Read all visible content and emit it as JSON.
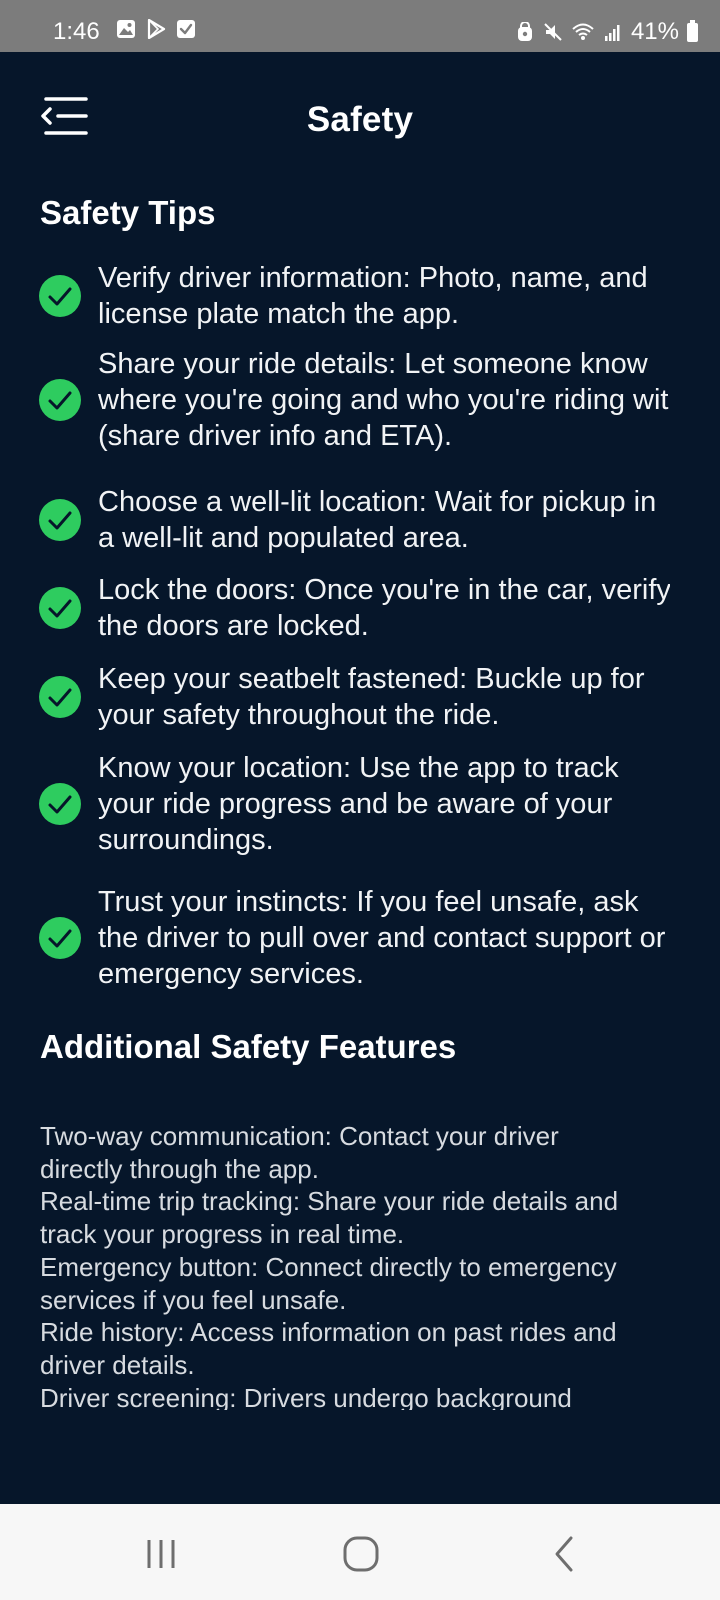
{
  "status_bar": {
    "time": "1:46",
    "battery": "41%",
    "left_icons": [
      "gallery-icon",
      "play-store-icon",
      "check-box-icon"
    ],
    "right_icons": [
      "lock-icon",
      "mute-icon",
      "wifi-icon",
      "signal-icon",
      "battery-icon"
    ]
  },
  "header": {
    "title": "Safety",
    "menu_icon": "menu-collapse-icon"
  },
  "safety_tips": {
    "title": "Safety Tips",
    "items": [
      "Verify driver information: Photo, name, and\nlicense plate match the app.",
      "Share your ride details: Let someone know\nwhere you're going and who you're riding with\n(share driver info and ETA).",
      "Choose a well-lit location: Wait for pickup in\na well-lit and populated area.",
      "Lock the doors: Once you're in the car, verify\nthe doors are locked.",
      "Keep your seatbelt fastened: Buckle up for\nyour safety throughout the ride.",
      "Know your location: Use the app to track\nyour ride progress and be aware of your\nsurroundings.",
      "Trust your instincts: If you feel unsafe, ask\nthe driver to pull over and contact support or\nemergency services."
    ]
  },
  "additional_features": {
    "title": "Additional Safety Features",
    "text": "Two-way communication: Contact your driver\ndirectly through the app.\nReal-time trip tracking: Share your ride details and\ntrack your progress in real time.\nEmergency button: Connect directly to emergency\nservices if you feel unsafe.\nRide history: Access information on past rides and\ndriver details.\nDriver screening: Drivers undergo background\nchecks and safety training before joining the"
  },
  "colors": {
    "background": "#06162a",
    "check": "#2ecc5f",
    "status_bar": "#7c7c7c",
    "nav_bar": "#f7f7f7"
  },
  "nav_bar": {
    "icons": [
      "recent-apps-icon",
      "home-icon",
      "back-icon"
    ]
  }
}
